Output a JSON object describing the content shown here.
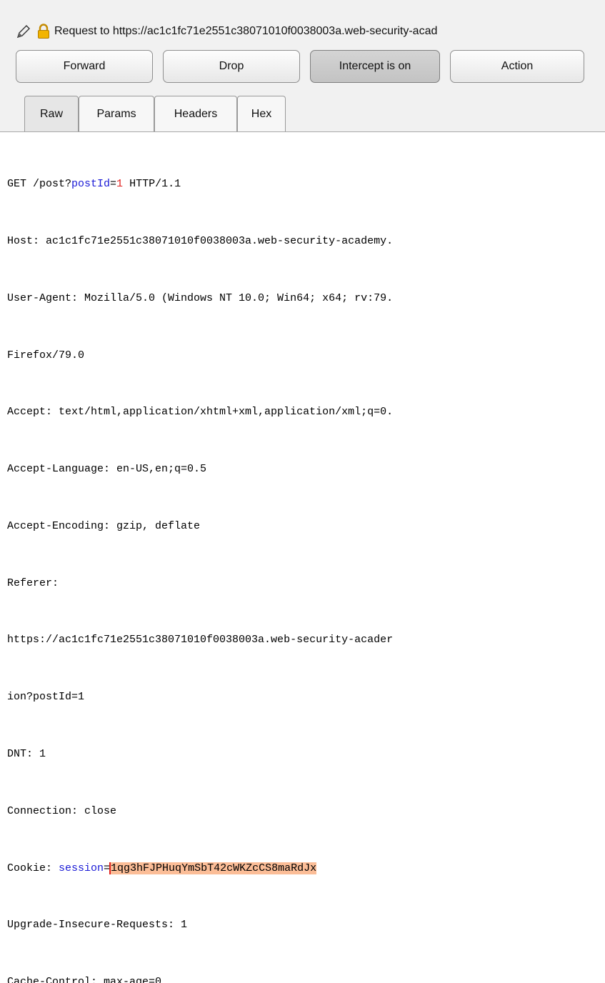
{
  "header": {
    "title": "Request to https://ac1c1fc71e2551c38071010f0038003a.web-security-acad",
    "edit_icon": "pencil-icon",
    "lock_icon": "lock-icon"
  },
  "toolbar": {
    "forward_label": "Forward",
    "drop_label": "Drop",
    "intercept_label": "Intercept is on",
    "action_label": "Action"
  },
  "tabs": [
    {
      "label": "Raw",
      "selected": true
    },
    {
      "label": "Params"
    },
    {
      "label": "Headers"
    },
    {
      "label": "Hex"
    }
  ],
  "request": {
    "line1": {
      "pre": "GET /post?",
      "param": "postId",
      "eq": "=",
      "value": "1",
      "post": " HTTP/1.1"
    },
    "host": "Host: ac1c1fc71e2551c38071010f0038003a.web-security-academy.",
    "user_agent": "User-Agent: Mozilla/5.0 (Windows NT 10.0; Win64; x64; rv:79.",
    "user_agent_cont": "Firefox/79.0",
    "accept": "Accept: text/html,application/xhtml+xml,application/xml;q=0.",
    "accept_language": "Accept-Language: en-US,en;q=0.5",
    "accept_encoding": "Accept-Encoding: gzip, deflate",
    "referer": "Referer:",
    "referer_url": "https://ac1c1fc71e2551c38071010f0038003a.web-security-acader",
    "referer_cont": "ion?postId=1",
    "dnt": "DNT: 1",
    "connection": "Connection: close",
    "cookie": {
      "pre": "Cookie: ",
      "name": "session",
      "eq": "=",
      "value": "1qg3hFJPHuqYmSbT42cWKZcCS8maRdJx"
    },
    "upgrade": "Upgrade-Insecure-Requests: 1",
    "cache_control": "Cache-Control: max-age=0"
  },
  "colors": {
    "param_name": "#1a1ad6",
    "param_value": "#e0201d",
    "selection": "#fbbd97",
    "lock": "#e8a800"
  }
}
